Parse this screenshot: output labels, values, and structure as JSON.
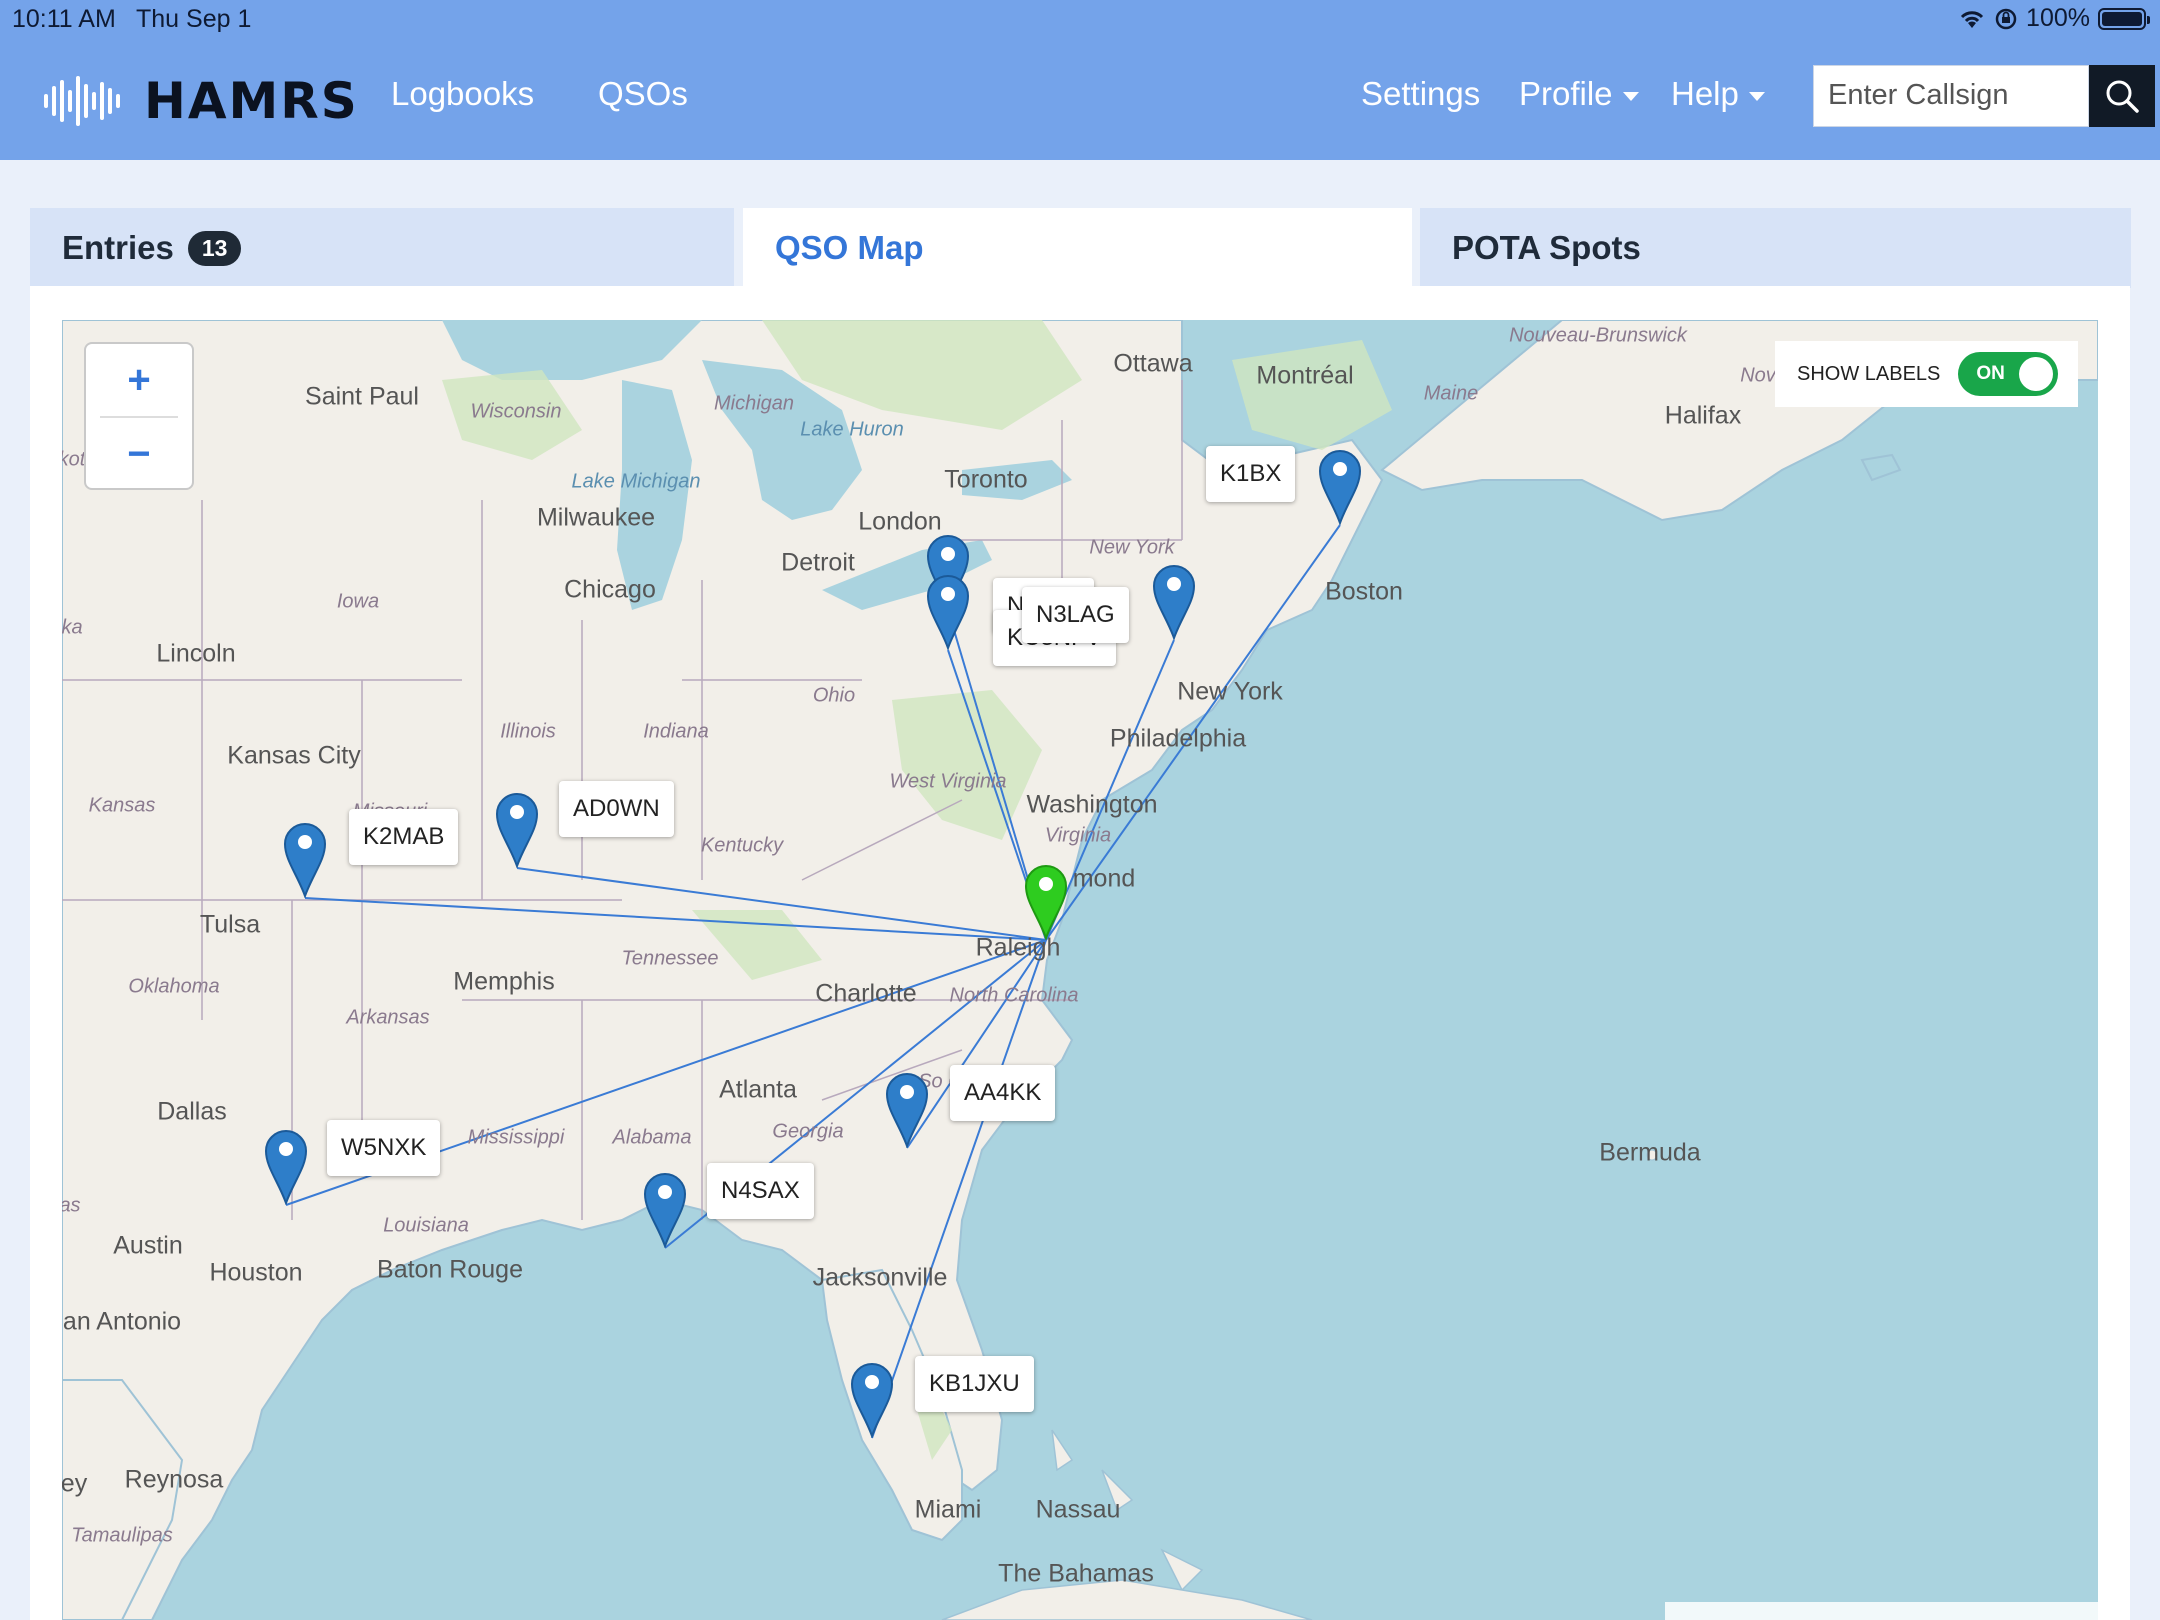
{
  "status_bar": {
    "time": "10:11 AM",
    "date": "Thu Sep 1",
    "battery": "100%"
  },
  "brand": {
    "name": "HAMRS"
  },
  "nav": {
    "logbooks": "Logbooks",
    "qsos": "QSOs",
    "settings": "Settings",
    "profile": "Profile",
    "help": "Help"
  },
  "search": {
    "placeholder": "Enter Callsign"
  },
  "tabs": {
    "entries": {
      "label": "Entries",
      "count": "13"
    },
    "qso_map": {
      "label": "QSO Map"
    },
    "pota_spots": {
      "label": "POTA Spots"
    }
  },
  "map": {
    "zoom_in": "+",
    "zoom_out": "−",
    "show_labels": {
      "label": "SHOW LABELS",
      "state": "ON"
    },
    "home_color": "#2ecc1f",
    "marker_color": "#2e7ec9",
    "line_color": "#3a7bd5",
    "callsigns": {
      "k1bx": "K1BX",
      "n3lag": "N3LAG",
      "n_hidden": "N",
      "kc3": "KC3NFV",
      "ad0wn": "AD0WN",
      "k2mab": "K2MAB",
      "aa4kk": "AA4KK",
      "w5nxk": "W5NXK",
      "n4sax": "N4SAX",
      "kb1jxu": "KB1JXU"
    },
    "places": {
      "ottawa": "Ottawa",
      "montreal": "Montréal",
      "maine": "Maine",
      "nouveau_brunswick": "Nouveau-Brunswick",
      "nova_scotia": "Nova Sc",
      "halifax": "Halifax",
      "saint_paul": "Saint Paul",
      "wisconsin": "Wisconsin",
      "michigan": "Michigan",
      "lake_huron": "Lake Huron",
      "toronto": "Toronto",
      "lake_michigan": "Lake Michigan",
      "milwaukee": "Milwaukee",
      "london": "London",
      "detroit": "Detroit",
      "new_york_state": "New York",
      "boston": "Boston",
      "iowa": "Iowa",
      "chicago": "Chicago",
      "lincoln": "Lincoln",
      "ka": "ka",
      "ohio": "Ohio",
      "new_york_city": "New York",
      "philadelphia": "Philadelphia",
      "illinois": "Illinois",
      "indiana": "Indiana",
      "kansas_city": "Kansas City",
      "west_virginia": "West Virginia",
      "washington": "Washington",
      "kansas": "Kansas",
      "missouri": "Missouri",
      "kentucky": "Kentucky",
      "virginia": "Virginia",
      "richmond": "mond",
      "tulsa": "Tulsa",
      "raleigh": "Raleigh",
      "tennessee": "Tennessee",
      "memphis": "Memphis",
      "oklahoma": "Oklahoma",
      "charlotte": "Charlotte",
      "north_carolina": "North Carolina",
      "arkansas": "Arkansas",
      "atlanta": "Atlanta",
      "south_carolina": "So Ca",
      "dallas": "Dallas",
      "mississippi": "Mississippi",
      "alabama": "Alabama",
      "georgia": "Georgia",
      "bermuda": "Bermuda",
      "louisiana": "Louisiana",
      "austin": "Austin",
      "houston": "Houston",
      "baton_rouge": "Baton Rouge",
      "jacksonville": "Jacksonville",
      "san_antonio": "an Antonio",
      "as": "as",
      "reynosa": "Reynosa",
      "ey": "ey",
      "tamaulipas": "Tamaulipas",
      "miami": "Miami",
      "nassau": "Nassau",
      "the_bahamas": "The Bahamas",
      "kot": "kot"
    }
  }
}
